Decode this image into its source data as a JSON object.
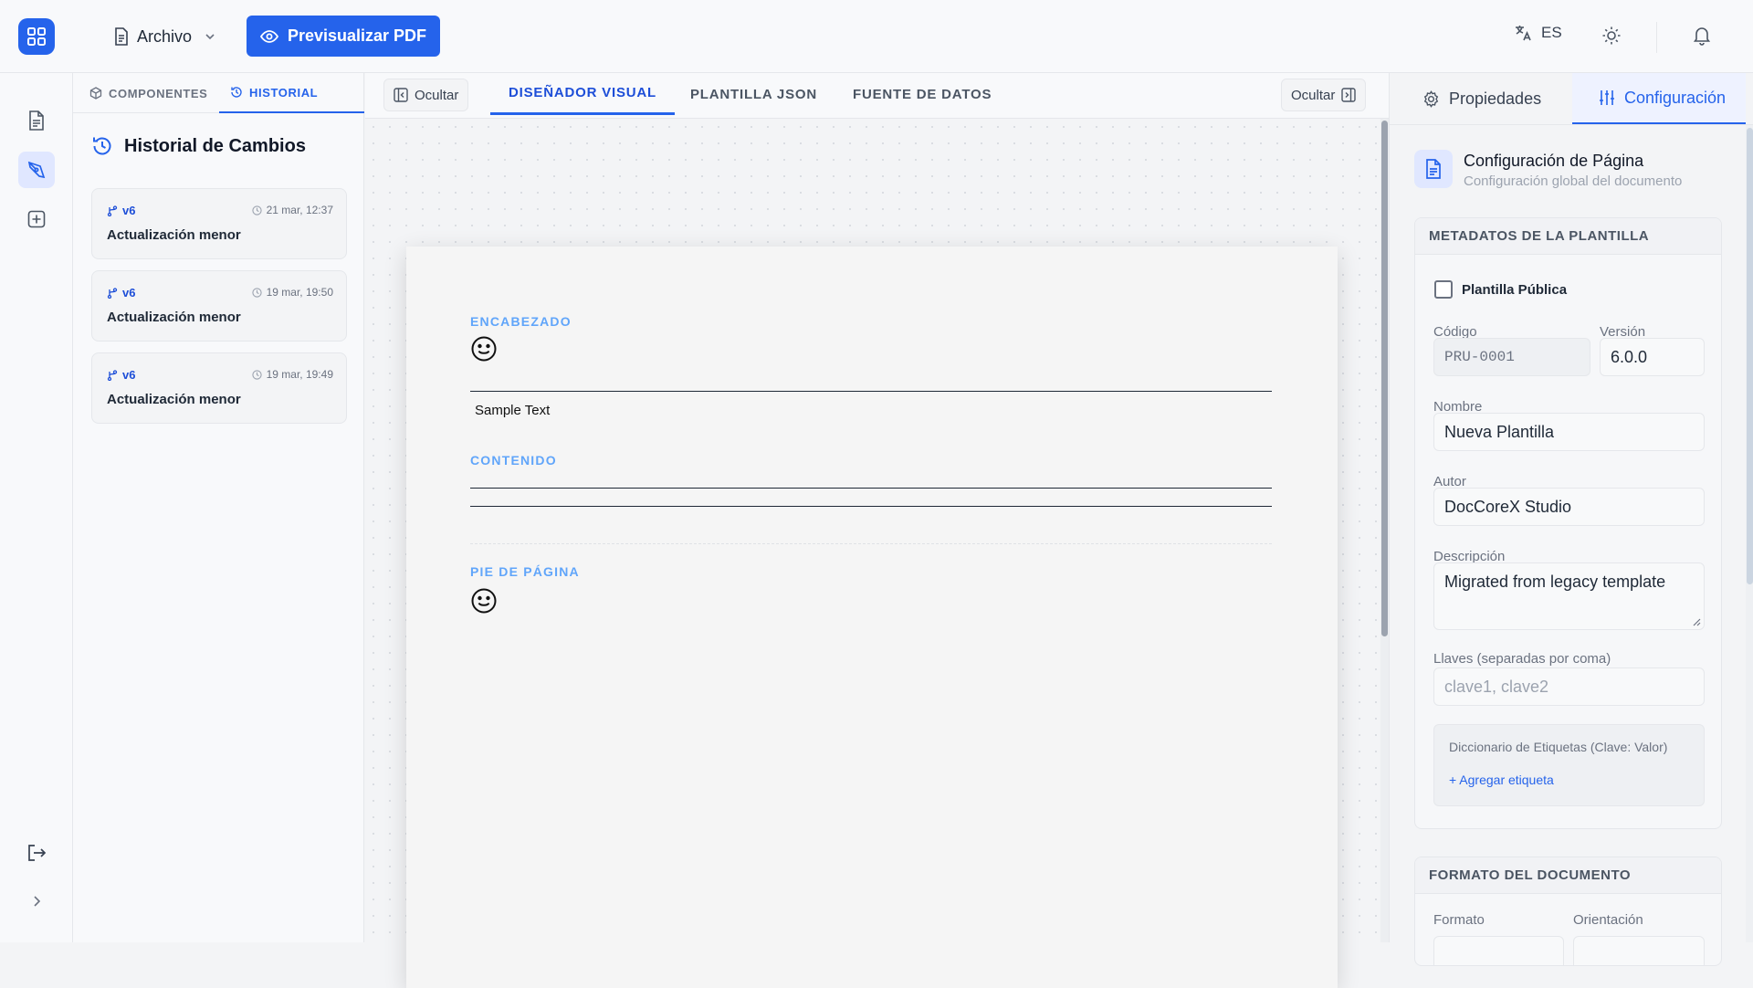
{
  "header": {
    "file_menu": "Archivo",
    "preview_button": "Previsualizar PDF",
    "language": "ES"
  },
  "left_panel": {
    "tabs": [
      {
        "label": "COMPONENTES"
      },
      {
        "label": "HISTORIAL"
      }
    ],
    "history": {
      "title": "Historial de Cambios",
      "entries": [
        {
          "version": "v6",
          "timestamp": "21 mar, 12:37",
          "message": "Actualización menor"
        },
        {
          "version": "v6",
          "timestamp": "19 mar, 19:50",
          "message": "Actualización menor"
        },
        {
          "version": "v6",
          "timestamp": "19 mar, 19:49",
          "message": "Actualización menor"
        }
      ]
    }
  },
  "center": {
    "hide_left": "Ocultar",
    "hide_right": "Ocultar",
    "tabs": [
      {
        "label": "DISEÑADOR VISUAL"
      },
      {
        "label": "PLANTILLA JSON"
      },
      {
        "label": "FUENTE DE DATOS"
      }
    ],
    "page": {
      "header_label": "ENCABEZADO",
      "sample_text": "Sample Text",
      "content_label": "CONTENIDO",
      "footer_label": "PIE DE PÁGINA"
    }
  },
  "right_panel": {
    "tabs": [
      {
        "label": "Propiedades"
      },
      {
        "label": "Configuración"
      }
    ],
    "config_title": "Configuración de Página",
    "config_subtitle": "Configuración global del documento",
    "metadata": {
      "heading": "METADATOS DE LA PLANTILLA",
      "public_label": "Plantilla Pública",
      "public_checked": false,
      "code_label": "Código",
      "code_value": "PRU-0001",
      "version_label": "Versión",
      "version_value": "6.0.0",
      "name_label": "Nombre",
      "name_value": "Nueva Plantilla",
      "author_label": "Autor",
      "author_value": "DocCoreX Studio",
      "description_label": "Descripción",
      "description_value": "Migrated from legacy template",
      "keys_label": "Llaves (separadas por coma)",
      "keys_placeholder": "clave1, clave2",
      "dict_label": "Diccionario de Etiquetas (Clave: Valor)",
      "add_label": "+ Agregar etiqueta"
    },
    "format": {
      "heading": "FORMATO DEL DOCUMENTO",
      "format_label": "Formato",
      "orientation_label": "Orientación"
    }
  },
  "colors": {
    "accent": "#2563eb",
    "section_label": "#60a5fa"
  }
}
